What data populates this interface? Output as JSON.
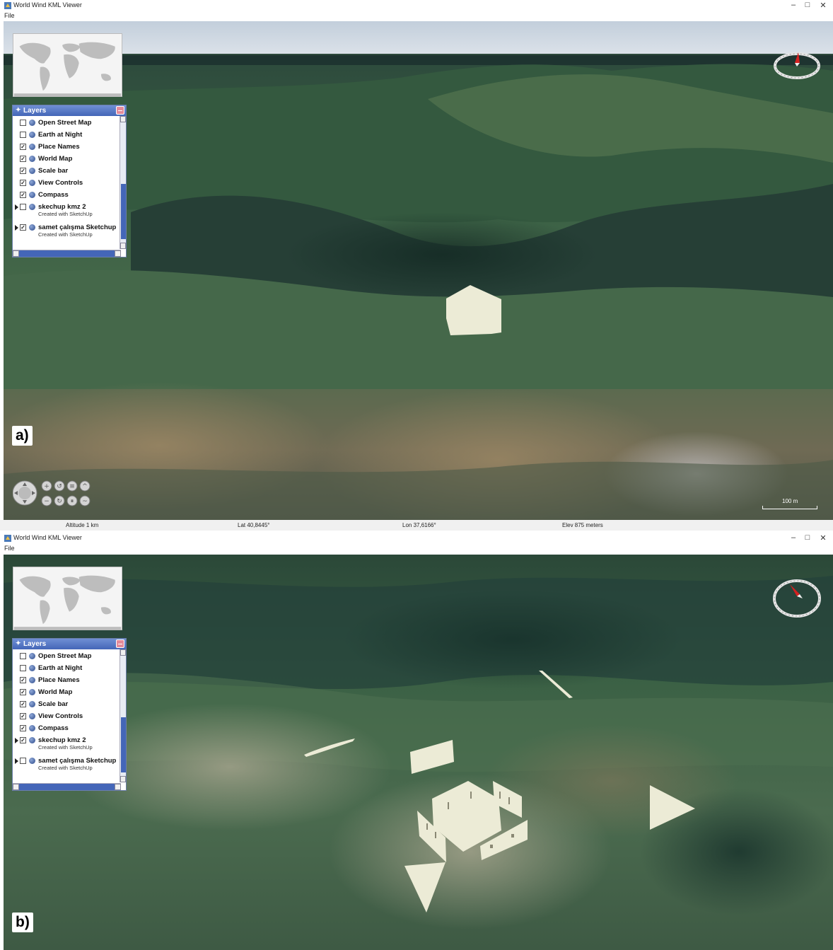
{
  "windows": [
    {
      "title": "World Wind KML Viewer",
      "menu": {
        "file": "File"
      },
      "window_controls": {
        "minimize": "–",
        "maximize": "□",
        "close": "✕"
      },
      "panel_label": "a)",
      "layers_panel": {
        "title": "Layers",
        "items": [
          {
            "label": "Open Street Map",
            "checked": false
          },
          {
            "label": "Earth at Night",
            "checked": false
          },
          {
            "label": "Place Names",
            "checked": true
          },
          {
            "label": "World Map",
            "checked": true
          },
          {
            "label": "Scale bar",
            "checked": true
          },
          {
            "label": "View Controls",
            "checked": true
          },
          {
            "label": "Compass",
            "checked": true
          },
          {
            "label": "skechup kmz 2",
            "sublabel": "Created with SketchUp",
            "checked": false,
            "expandable": true
          },
          {
            "label": "samet çalışma Sketchup",
            "sublabel": "Created with SketchUp",
            "checked": true,
            "expandable": true
          }
        ]
      },
      "scale_bar": "100 m",
      "status": {
        "altitude": "Altitude    1 km",
        "lat": "Lat 40,8445°",
        "lon": "Lon 37,6166°",
        "elev": "Elev    875 meters"
      }
    },
    {
      "title": "World Wind KML Viewer",
      "menu": {
        "file": "File"
      },
      "window_controls": {
        "minimize": "–",
        "maximize": "□",
        "close": "✕"
      },
      "panel_label": "b)",
      "layers_panel": {
        "title": "Layers",
        "items": [
          {
            "label": "Open Street Map",
            "checked": false
          },
          {
            "label": "Earth at Night",
            "checked": false
          },
          {
            "label": "Place Names",
            "checked": true
          },
          {
            "label": "World Map",
            "checked": true
          },
          {
            "label": "Scale bar",
            "checked": true
          },
          {
            "label": "View Controls",
            "checked": true
          },
          {
            "label": "Compass",
            "checked": true
          },
          {
            "label": "skechup kmz 2",
            "sublabel": "Created with SketchUp",
            "checked": true,
            "expandable": true
          },
          {
            "label": "samet çalışma Sketchup",
            "sublabel": "Created with SketchUp",
            "checked": false,
            "expandable": true
          }
        ]
      }
    }
  ],
  "colors": {
    "sky": "#b9c8d8",
    "terrain_dark": "#1f3a2a",
    "terrain_green": "#3d6b45",
    "model_fill": "#ecebd6",
    "layers_header": "#4466b8"
  },
  "icons": [
    "app-icon",
    "globe-icon",
    "compass-icon",
    "pan-control-icon",
    "zoom-in-icon",
    "zoom-out-icon",
    "heading-icon",
    "pitch-icon"
  ]
}
